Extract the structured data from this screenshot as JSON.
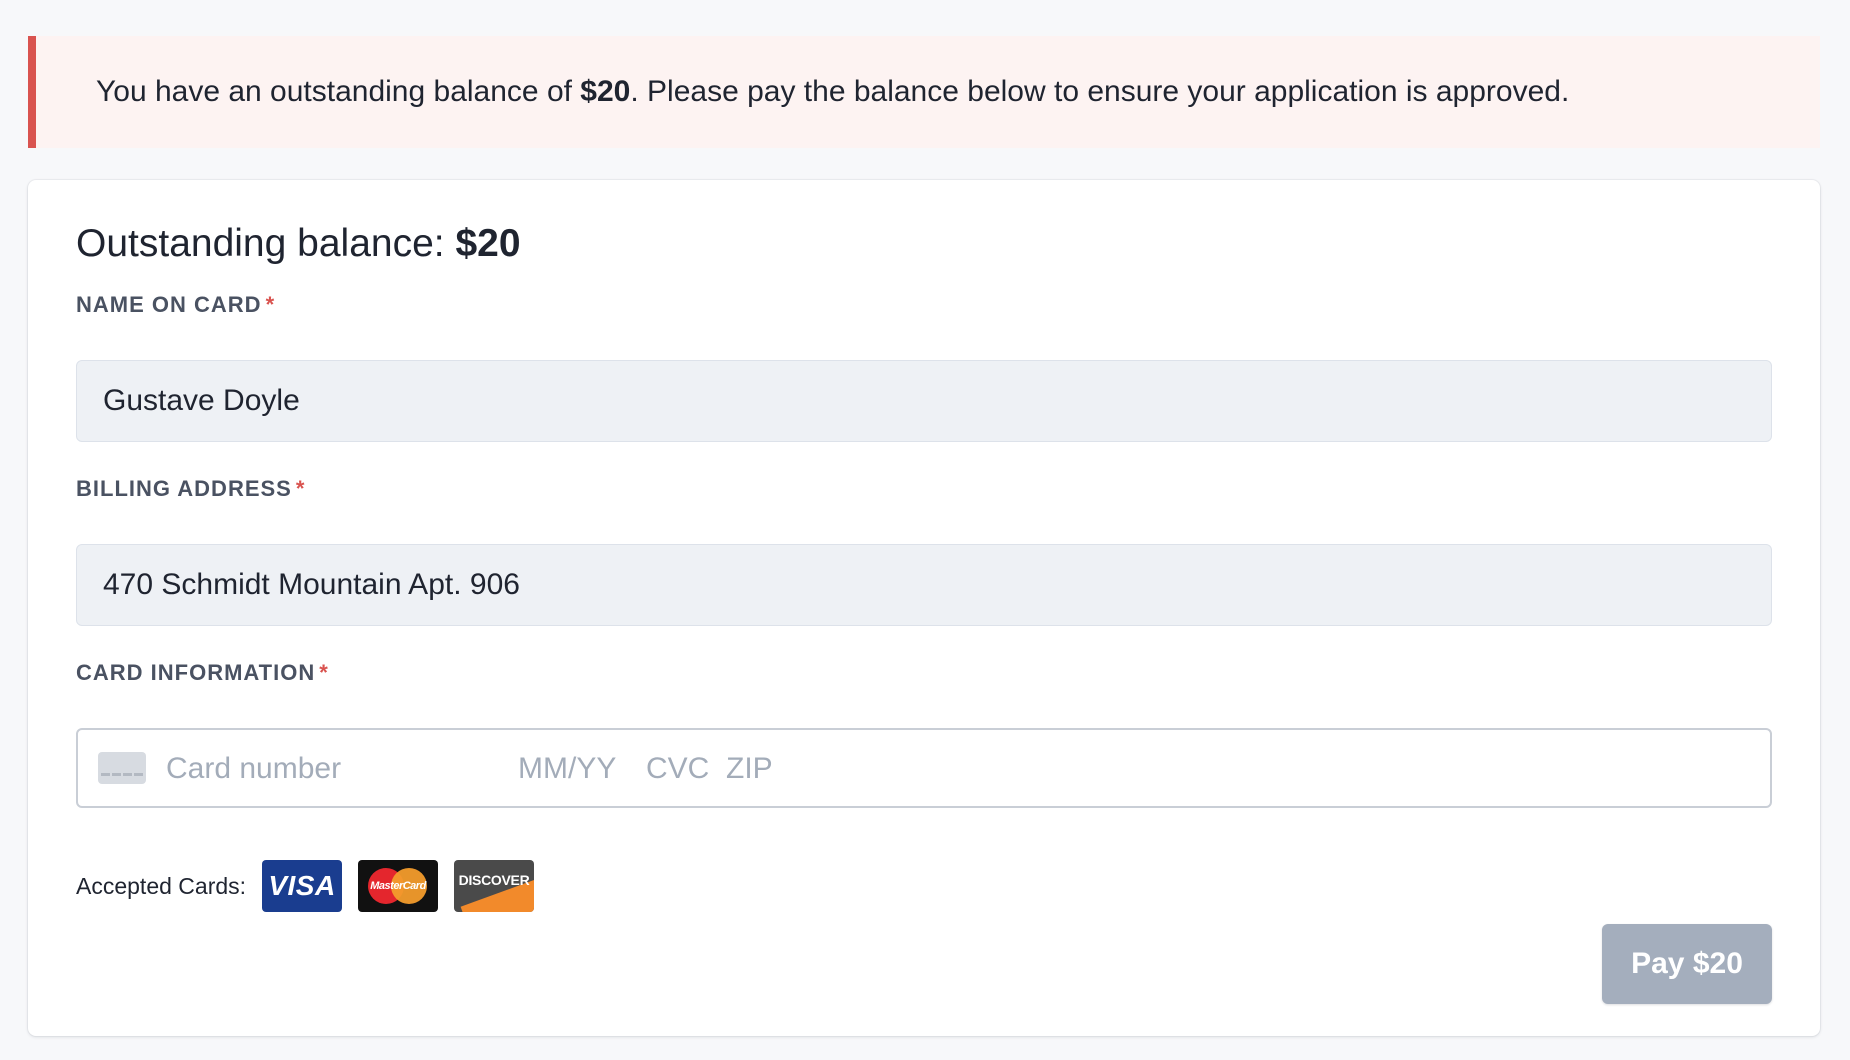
{
  "alert": {
    "prefix": "You have an outstanding balance of ",
    "amount": "$20",
    "suffix": ". Please pay the balance below to ensure your application is approved."
  },
  "form": {
    "balance_label": "Outstanding balance: ",
    "balance_amount": "$20",
    "name_label": "NAME ON CARD",
    "name_value": "Gustave Doyle",
    "address_label": "BILLING ADDRESS",
    "address_value": "470 Schmidt Mountain Apt. 906",
    "card_label": "CARD INFORMATION",
    "required_mark": "*",
    "card_number_placeholder": "Card number",
    "expiry_placeholder": "MM/YY",
    "cvc_placeholder": "CVC",
    "zip_placeholder": "ZIP",
    "accepted_label": "Accepted Cards:",
    "accepted_cards": [
      "VISA",
      "MasterCard",
      "DISCOVER"
    ],
    "pay_button": "Pay $20"
  },
  "colors": {
    "alert_border": "#d9534f",
    "alert_background": "#fdf3f2",
    "button_disabled": "#a4aebd",
    "required": "#d9534f"
  },
  "icons": {
    "card_field": "credit-card-icon"
  }
}
